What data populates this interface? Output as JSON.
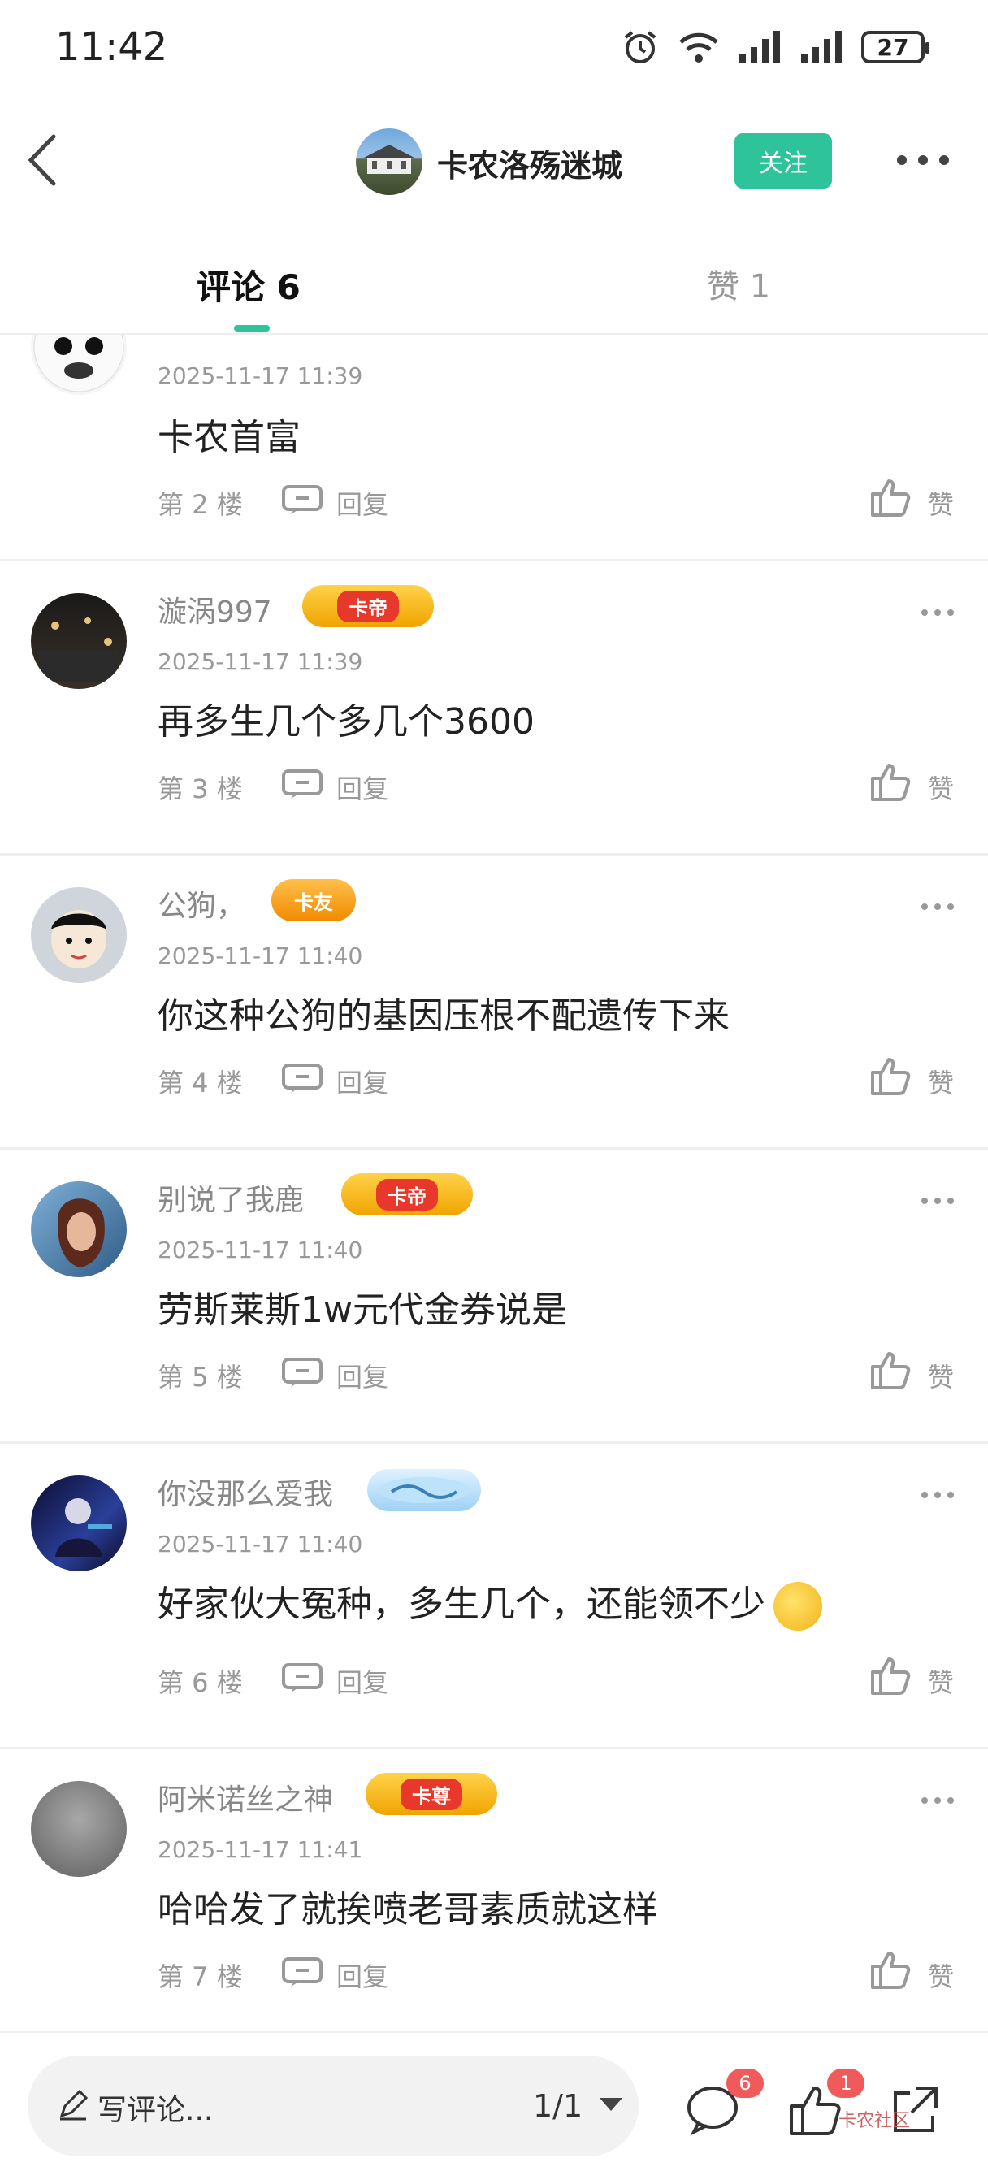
{
  "status_bar": {
    "time": "11:42",
    "battery": "27"
  },
  "header": {
    "title": "卡农洛殇迷城",
    "follow_label": "关注"
  },
  "tabs": {
    "comments": "评论 6",
    "likes": "赞 1"
  },
  "comments": [
    {
      "name": "",
      "badge": "",
      "time": "2025-11-17 11:39",
      "text": "卡农首富",
      "floor": "第 2 楼",
      "reply": "回复",
      "like": "赞"
    },
    {
      "name": "漩涡997",
      "badge": "卡帝",
      "time": "2025-11-17 11:39",
      "text": "再多生几个多几个3600",
      "floor": "第 3 楼",
      "reply": "回复",
      "like": "赞"
    },
    {
      "name": "公狗，",
      "badge": "卡友",
      "time": "2025-11-17 11:40",
      "text": "你这种公狗的基因压根不配遗传下来",
      "floor": "第 4 楼",
      "reply": "回复",
      "like": "赞"
    },
    {
      "name": "别说了我鹿",
      "badge": "卡帝",
      "time": "2025-11-17 11:40",
      "text": "劳斯莱斯1w元代金券说是",
      "floor": "第 5 楼",
      "reply": "回复",
      "like": "赞"
    },
    {
      "name": "你没那么爱我",
      "badge": "",
      "time": "2025-11-17 11:40",
      "text": "好家伙大冤种，多生几个，还能领不少",
      "floor": "第 6 楼",
      "reply": "回复",
      "like": "赞"
    },
    {
      "name": "阿米诺丝之神",
      "badge": "卡尊",
      "time": "2025-11-17 11:41",
      "text": "哈哈发了就挨喷老哥素质就这样",
      "floor": "第 7 楼",
      "reply": "回复",
      "like": "赞"
    }
  ],
  "bottom_bar": {
    "placeholder": "写评论...",
    "page": "1/1",
    "comment_count": "6",
    "like_count": "1",
    "watermark": "卡农社区"
  },
  "colors": {
    "accent": "#2ec39a",
    "badge_red": "#f05a5a"
  }
}
